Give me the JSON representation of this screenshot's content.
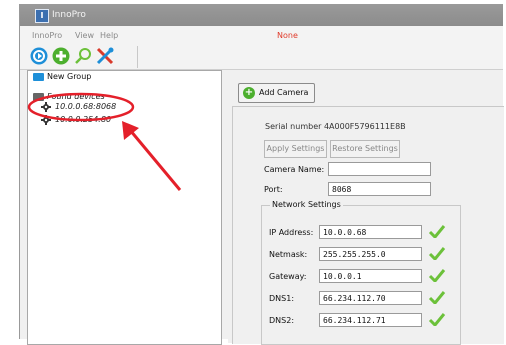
{
  "window": {
    "app_title": "InnoPro",
    "status": "None"
  },
  "menu": [
    "InnoPro",
    "View",
    "Help"
  ],
  "toolbar": {
    "buttons": [
      {
        "name": "connect-button",
        "icon": "play-circle-icon"
      },
      {
        "name": "add-button",
        "icon": "plus-circle-icon"
      },
      {
        "name": "search-button",
        "icon": "magnifier-icon"
      },
      {
        "name": "tools-button",
        "icon": "tools-icon"
      }
    ]
  },
  "tree": {
    "group": "New Group",
    "found": "Found devices",
    "devices": [
      "10.0.0.68:8068",
      "10.0.0.254:80"
    ]
  },
  "panel": {
    "add_camera": "Add Camera",
    "serial": "Serial number 4A000F5796111E8B",
    "apply": "Apply Settings",
    "restore": "Restore Settings",
    "camera_name_label": "Camera Name:",
    "camera_name": "",
    "port_label": "Port:",
    "port": "8068",
    "network": {
      "title": "Network Settings",
      "rows": [
        {
          "label": "IP Address:",
          "value": "10.0.0.68"
        },
        {
          "label": "Netmask:",
          "value": "255.255.255.0"
        },
        {
          "label": "Gateway:",
          "value": "10.0.0.1"
        },
        {
          "label": "DNS1:",
          "value": "66.234.112.70"
        },
        {
          "label": "DNS2:",
          "value": "66.234.112.71"
        }
      ]
    }
  },
  "colors": {
    "accent_blue": "#1e8fd8",
    "check_green": "#6cc13a",
    "annotation_red": "#e4202a"
  }
}
